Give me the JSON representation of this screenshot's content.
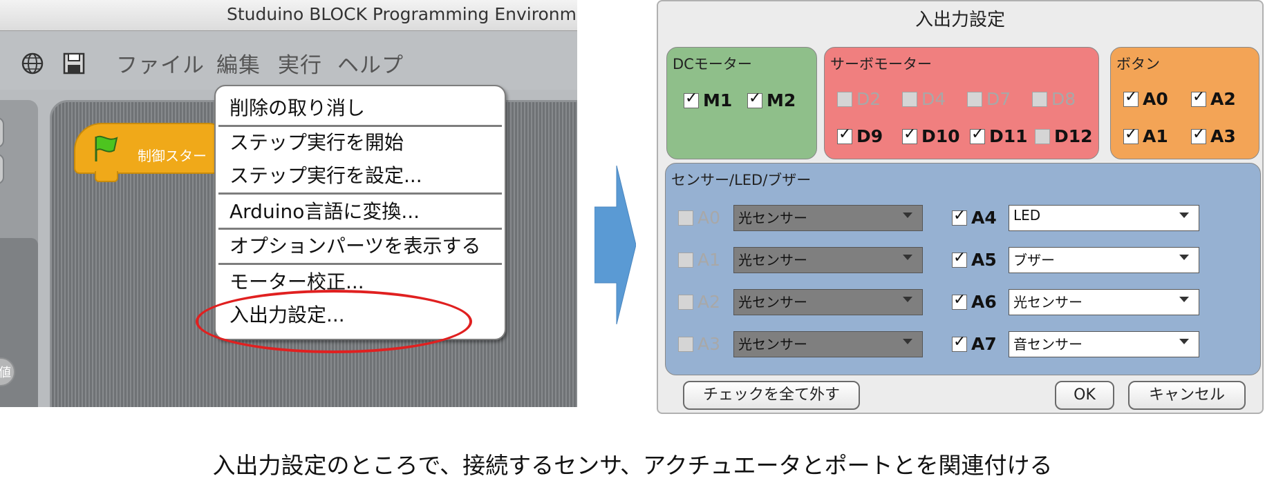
{
  "left_app": {
    "title": "Studuino BLOCK Programming Environment",
    "icons": [
      "globe-icon",
      "save-icon"
    ],
    "menus": [
      "ファイル",
      "編集",
      "実行",
      "ヘルプ"
    ],
    "start_block_label": "制御スター",
    "value_badge": "値",
    "context_menu": [
      "削除の取り消し",
      "ステップ実行を開始",
      "ステップ実行を設定...",
      "Arduino言語に変換...",
      "オプションパーツを表示する",
      "モーター校正...",
      "入出力設定..."
    ]
  },
  "dialog": {
    "title": "入出力設定",
    "dc_motor": {
      "title": "DCモーター",
      "items": [
        {
          "label": "M1",
          "checked": true
        },
        {
          "label": "M2",
          "checked": true
        }
      ]
    },
    "servo_motor": {
      "title": "サーボモーター",
      "items": [
        {
          "label": "D2",
          "checked": false
        },
        {
          "label": "D4",
          "checked": false
        },
        {
          "label": "D7",
          "checked": false
        },
        {
          "label": "D8",
          "checked": false
        },
        {
          "label": "D9",
          "checked": true
        },
        {
          "label": "D10",
          "checked": true
        },
        {
          "label": "D11",
          "checked": true
        },
        {
          "label": "D12",
          "checked": false
        }
      ]
    },
    "button": {
      "title": "ボタン",
      "items": [
        {
          "label": "A0",
          "checked": true
        },
        {
          "label": "A2",
          "checked": true
        },
        {
          "label": "A1",
          "checked": true
        },
        {
          "label": "A3",
          "checked": true
        }
      ]
    },
    "sensor": {
      "title": "センサー/LED/ブザー",
      "left": [
        {
          "port": "A0",
          "checked": false,
          "value": "光センサー"
        },
        {
          "port": "A1",
          "checked": false,
          "value": "光センサー"
        },
        {
          "port": "A2",
          "checked": false,
          "value": "光センサー"
        },
        {
          "port": "A3",
          "checked": false,
          "value": "光センサー"
        }
      ],
      "right": [
        {
          "port": "A4",
          "checked": true,
          "value": "LED"
        },
        {
          "port": "A5",
          "checked": true,
          "value": "ブザー"
        },
        {
          "port": "A6",
          "checked": true,
          "value": "光センサー"
        },
        {
          "port": "A7",
          "checked": true,
          "value": "音センサー"
        }
      ]
    },
    "uncheck_all": "チェックを全て外す",
    "ok": "OK",
    "cancel": "キャンセル"
  },
  "colors": {
    "dc_panel": "#8fbf8a",
    "servo_panel": "#f07f7f",
    "button_panel": "#f3a456",
    "sensor_panel": "#96b1d2",
    "arrow": "#5a9ad4",
    "highlight": "#e02020"
  },
  "caption": "入出力設定のところで、接続するセンサ、アクチュエータとポートとを関連付ける"
}
